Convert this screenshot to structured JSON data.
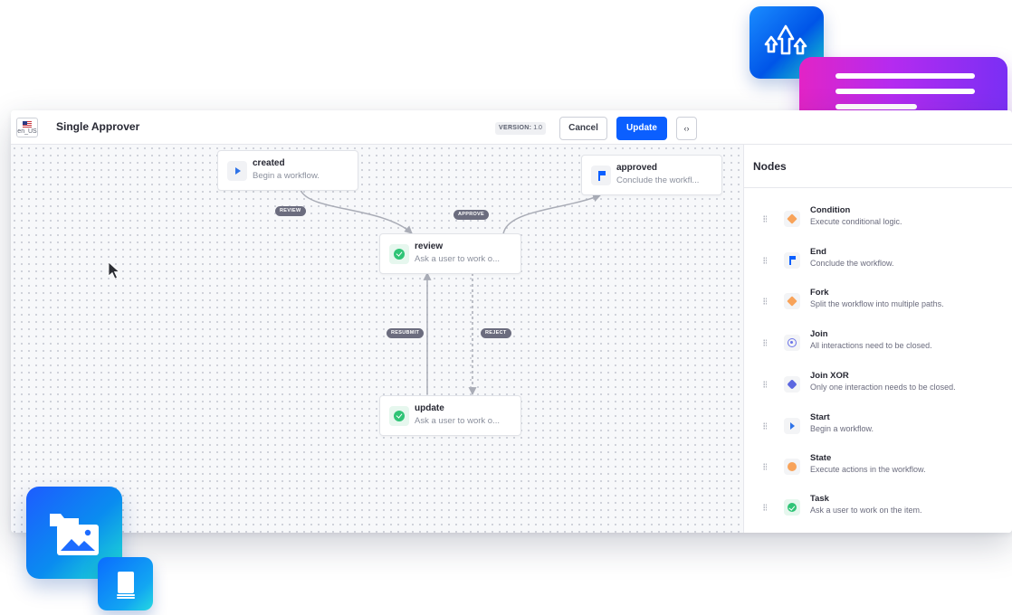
{
  "header": {
    "locale": "en_US",
    "title": "Single Approver",
    "version_label": "VERSION:",
    "version_value": "1.0",
    "cancel_label": "Cancel",
    "update_label": "Update",
    "code_label": "‹›"
  },
  "diagram": {
    "nodes": [
      {
        "title": "created",
        "desc": "Begin a workflow.",
        "icon": "start-play-icon"
      },
      {
        "title": "approved",
        "desc": "Conclude the workfl...",
        "icon": "end-flag-icon"
      },
      {
        "title": "review",
        "desc": "Ask a user to work o...",
        "icon": "task-check-icon"
      },
      {
        "title": "update",
        "desc": "Ask a user to work o...",
        "icon": "task-check-icon"
      }
    ],
    "transitions": [
      "REVIEW",
      "APPROVE",
      "RESUBMIT",
      "REJECT"
    ]
  },
  "panel": {
    "title": "Nodes",
    "items": [
      {
        "title": "Condition",
        "desc": "Execute conditional logic.",
        "icon": "condition-diamond-icon"
      },
      {
        "title": "End",
        "desc": "Conclude the workflow.",
        "icon": "end-flag-icon"
      },
      {
        "title": "Fork",
        "desc": "Split the workflow into multiple paths.",
        "icon": "fork-diamond-icon"
      },
      {
        "title": "Join",
        "desc": "All interactions need to be closed.",
        "icon": "join-ring-icon"
      },
      {
        "title": "Join XOR",
        "desc": "Only one interaction needs to be closed.",
        "icon": "join-xor-icon"
      },
      {
        "title": "Start",
        "desc": "Begin a workflow.",
        "icon": "start-play-icon"
      },
      {
        "title": "State",
        "desc": "Execute actions in the workflow.",
        "icon": "state-dot-icon"
      },
      {
        "title": "Task",
        "desc": "Ask a user to work on the item.",
        "icon": "task-check-icon"
      }
    ]
  },
  "colors": {
    "primary": "#0b5fff",
    "task_green": "#2fc476",
    "orange": "#f8a35a",
    "label_gray": "#6b6c7e"
  }
}
